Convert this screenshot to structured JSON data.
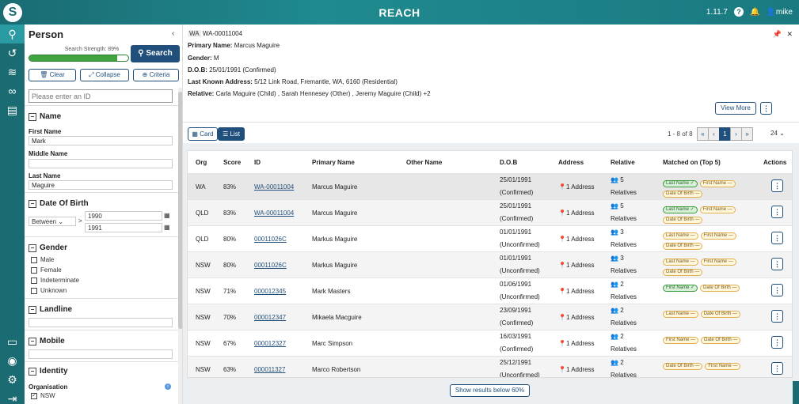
{
  "app": {
    "title": "REACH",
    "version": "1.11.7",
    "user": "mike"
  },
  "rail": {
    "icons": [
      "search-icon",
      "history-icon",
      "feed-icon",
      "link-icon",
      "document-icon",
      "report-icon",
      "eye-icon",
      "settings-icon",
      "logout-icon"
    ]
  },
  "sidebar": {
    "title": "Person",
    "strength_label": "Search Strength: 89%",
    "strength": 0.89,
    "search_label": "Search",
    "clear_label": "Clear",
    "collapse_label": "Collapse",
    "criteria_label": "Criteria",
    "id_placeholder": "Please enter an ID",
    "name": {
      "title": "Name",
      "first_label": "First Name",
      "first_value": "Mark",
      "middle_label": "Middle Name",
      "middle_value": "",
      "last_label": "Last Name",
      "last_value": "Maguire"
    },
    "dob": {
      "title": "Date Of Birth",
      "mode": "Between",
      "from": "1990",
      "to": "1991"
    },
    "gender": {
      "title": "Gender",
      "options": [
        "Male",
        "Female",
        "Indeterminate",
        "Unknown"
      ]
    },
    "landline": {
      "title": "Landline"
    },
    "mobile": {
      "title": "Mobile"
    },
    "identity": {
      "title": "Identity",
      "org_label": "Organisation",
      "org_option": "NSW"
    }
  },
  "detail": {
    "org": "WA",
    "id": "WA-00011004",
    "primary_name_label": "Primary Name:",
    "primary_name": "Marcus Maguire",
    "gender_label": "Gender:",
    "gender": "M",
    "dob_label": "D.O.B:",
    "dob": "25/01/1991 (Confirmed)",
    "address_label": "Last Known Address:",
    "address": "5/12 Link Road, Fremantle, WA, 6160 (Residential)",
    "relative_label": "Relative:",
    "relative": "Carla Maguire (Child) , Sarah Hennesey (Other) , Jeremy Maguire (Child) +2",
    "view_more": "View More"
  },
  "toolbar": {
    "card_label": "Card",
    "list_label": "List",
    "range": "1 - 8 of 8",
    "page": "1",
    "per_page": "24"
  },
  "table": {
    "headers": {
      "org": "Org",
      "score": "Score",
      "id": "ID",
      "primary": "Primary Name",
      "other": "Other Name",
      "dob": "D.O.B",
      "address": "Address",
      "relative": "Relative",
      "matched": "Matched on (Top 5)",
      "actions": "Actions"
    },
    "rows": [
      {
        "org": "WA",
        "score": "83%",
        "id": "WA-00011004",
        "name": "Marcus Maguire",
        "dob": "25/01/1991",
        "status": "(Confirmed)",
        "address": "1 Address",
        "rel_count": "5",
        "rel_label": "Relatives",
        "badges": [
          [
            "Last Name ✓",
            "g"
          ],
          [
            "First Name —",
            "y"
          ],
          [
            "Date Of Birth —",
            "y"
          ]
        ]
      },
      {
        "org": "QLD",
        "score": "83%",
        "id": "WA-00011004",
        "name": "Marcus Maguire",
        "dob": "25/01/1991",
        "status": "(Confirmed)",
        "address": "1 Address",
        "rel_count": "5",
        "rel_label": "Relatives",
        "badges": [
          [
            "Last Name ✓",
            "g"
          ],
          [
            "First Name —",
            "y"
          ],
          [
            "Date Of Birth —",
            "y"
          ]
        ]
      },
      {
        "org": "QLD",
        "score": "80%",
        "id": "00011026C",
        "name": "Markus Maguire",
        "dob": "01/01/1991",
        "status": "(Unconfirmed)",
        "address": "1 Address",
        "rel_count": "3",
        "rel_label": "Relatives",
        "badges": [
          [
            "Last Name —",
            "y"
          ],
          [
            "First Name —",
            "y"
          ],
          [
            "Date Of Birth —",
            "y"
          ]
        ]
      },
      {
        "org": "NSW",
        "score": "80%",
        "id": "00011026C",
        "name": "Markus Maguire",
        "dob": "01/01/1991",
        "status": "(Unconfirmed)",
        "address": "1 Address",
        "rel_count": "3",
        "rel_label": "Relatives",
        "badges": [
          [
            "Last Name —",
            "y"
          ],
          [
            "First Name —",
            "y"
          ],
          [
            "Date Of Birth —",
            "y"
          ]
        ]
      },
      {
        "org": "NSW",
        "score": "71%",
        "id": "000012345",
        "name": "Mark Masters",
        "dob": "01/06/1991",
        "status": "(Unconfirmed)",
        "address": "1 Address",
        "rel_count": "2",
        "rel_label": "Relatives",
        "badges": [
          [
            "First Name ✓",
            "g"
          ],
          [
            "Date Of Birth —",
            "y"
          ]
        ]
      },
      {
        "org": "NSW",
        "score": "70%",
        "id": "000012347",
        "name": "Mikaela Macguire",
        "dob": "23/09/1991",
        "status": "(Confirmed)",
        "address": "1 Address",
        "rel_count": "2",
        "rel_label": "Relatives",
        "badges": [
          [
            "Last Name —",
            "y"
          ],
          [
            "Date Of Birth —",
            "y"
          ]
        ]
      },
      {
        "org": "NSW",
        "score": "67%",
        "id": "000012327",
        "name": "Marc Simpson",
        "dob": "16/03/1991",
        "status": "(Confirmed)",
        "address": "1 Address",
        "rel_count": "2",
        "rel_label": "Relatives",
        "badges": [
          [
            "First Name —",
            "y"
          ],
          [
            "Date Of Birth —",
            "y"
          ]
        ]
      },
      {
        "org": "NSW",
        "score": "63%",
        "id": "000011327",
        "name": "Marco Robertson",
        "dob": "25/12/1991",
        "status": "(Unconfirmed)",
        "address": "1 Address",
        "rel_count": "2",
        "rel_label": "Relatives",
        "badges": [
          [
            "Date Of Birth —",
            "y"
          ],
          [
            "First Name —",
            "y"
          ]
        ]
      }
    ]
  },
  "show_more": "Show results below 60%",
  "colors": {
    "brand": "#1a6b72",
    "primary": "#1f4f7a",
    "match": "#3fa33f",
    "partial": "#e0b050"
  }
}
